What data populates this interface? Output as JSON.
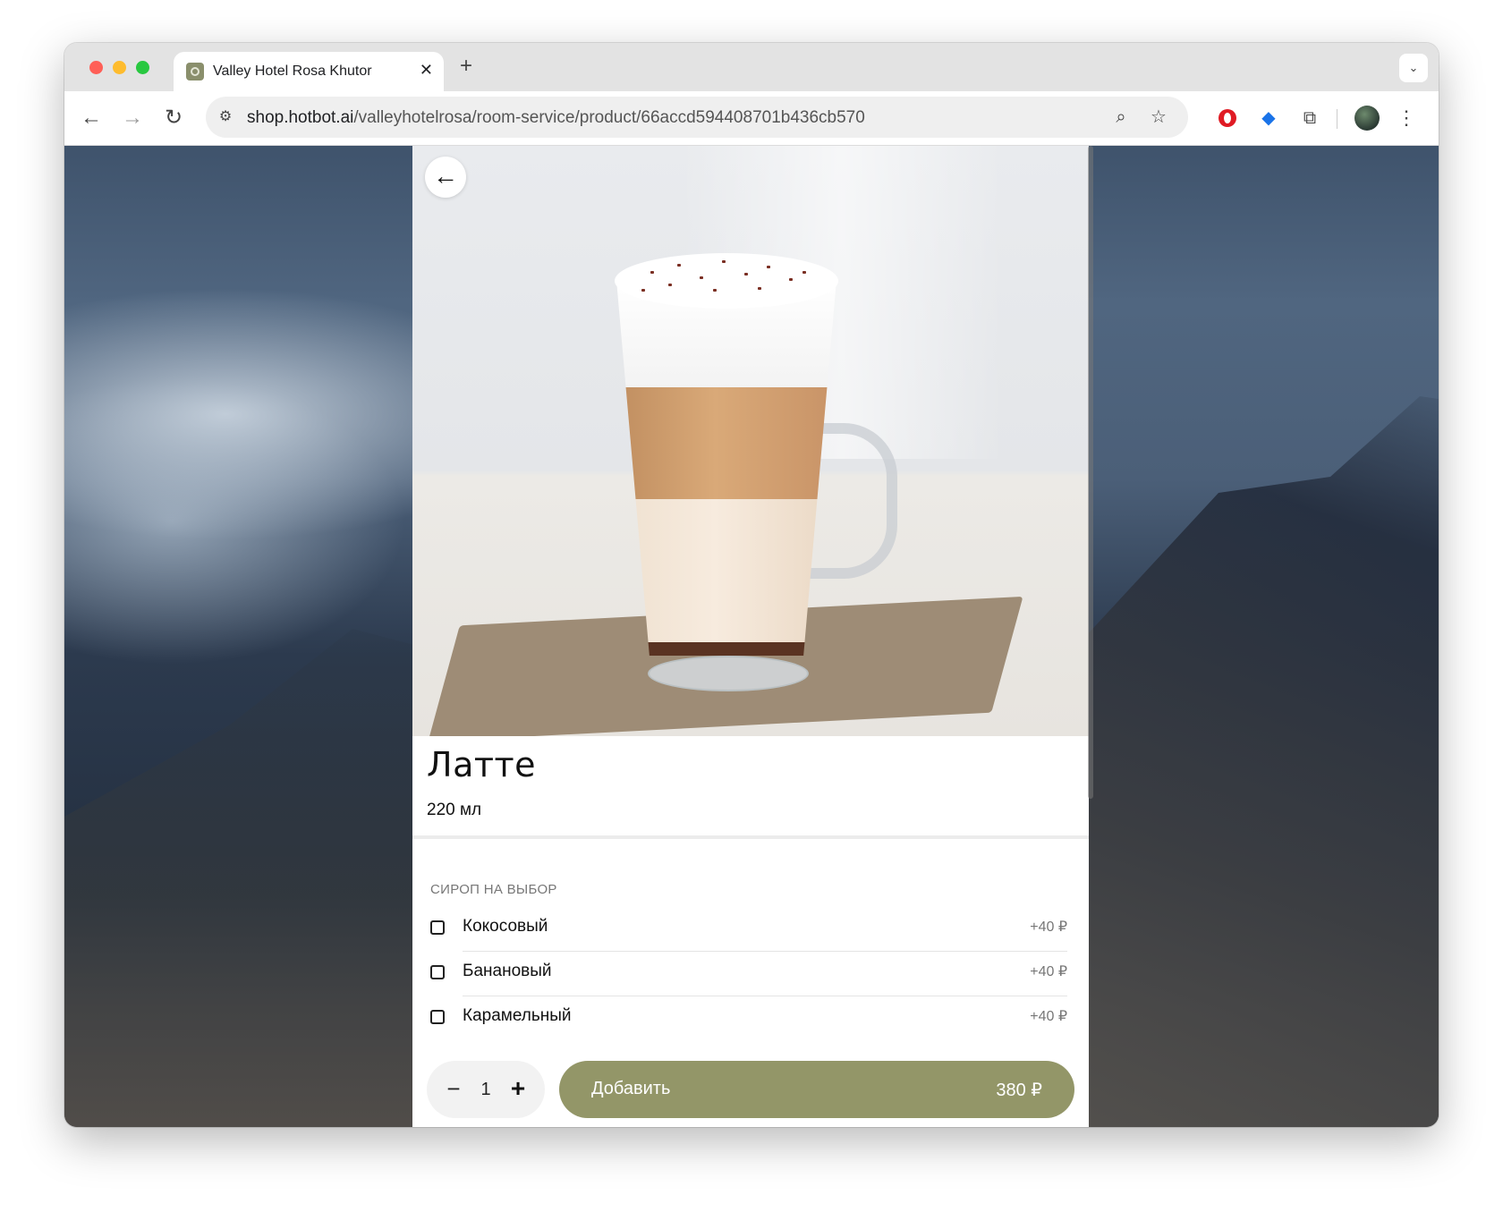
{
  "browser": {
    "tab_title": "Valley Hotel Rosa Khutor",
    "tab_close": "✕",
    "new_tab": "+",
    "url_host": "shop.hotbot.ai",
    "url_path": "/valleyhotelrosa/room-service/product/66accd594408701b436cb570",
    "icons": {
      "back": "arrow-left-icon",
      "forward": "arrow-right-icon",
      "reload": "reload-icon",
      "site_info": "tune-icon",
      "zoom": "zoom-icon",
      "bookmark": "star-icon",
      "menu": "kebab-icon"
    }
  },
  "product": {
    "back_icon": "arrow-left-icon",
    "title": "Латте",
    "volume": "220 мл",
    "options_heading": "СИРОП НА ВЫБОР",
    "options": [
      {
        "label": "Кокосовый",
        "price": "+40 ₽",
        "checked": false
      },
      {
        "label": "Банановый",
        "price": "+40 ₽",
        "checked": false
      },
      {
        "label": "Карамельный",
        "price": "+40 ₽",
        "checked": false
      }
    ],
    "quantity": "1",
    "minus": "−",
    "plus": "+",
    "add_label": "Добавить",
    "add_price": "380 ₽"
  },
  "colors": {
    "accent": "#939668",
    "text": "#111111",
    "muted": "#777777"
  }
}
